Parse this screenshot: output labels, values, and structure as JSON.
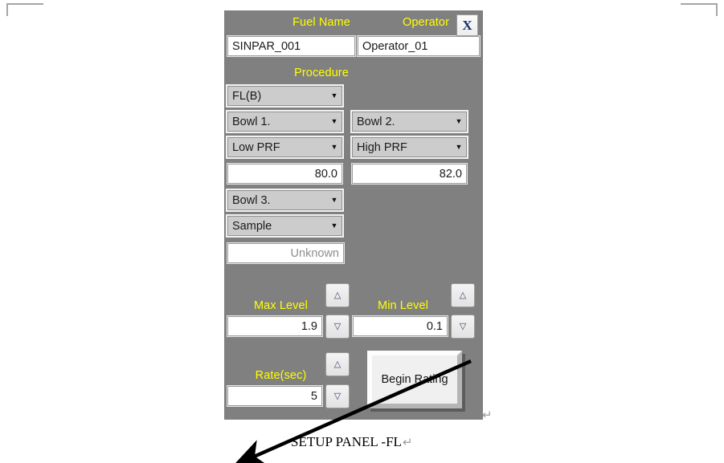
{
  "document": {
    "caption": "SETUP PANEL -FL",
    "paragraph_mark": "↵"
  },
  "panel": {
    "close_button": "X",
    "fields": {
      "fuel_name_label": "Fuel Name",
      "fuel_name_value": "SINPAR_001",
      "operator_label": "Operator",
      "operator_value": "Operator_01",
      "procedure_label": "Procedure",
      "procedure_value": "FL(B)",
      "bowl1_value": "Bowl 1.",
      "bowl2_value": "Bowl 2.",
      "low_prf_value": "Low PRF",
      "high_prf_value": "High PRF",
      "low_prf_number": "80.0",
      "high_prf_number": "82.0",
      "bowl3_value": "Bowl 3.",
      "sample_value": "Sample",
      "sample_number": "Unknown",
      "max_level_label": "Max Level",
      "max_level_value": "1.9",
      "min_level_label": "Min Level",
      "min_level_value": "0.1",
      "rate_label": "Rate(sec)",
      "rate_value": "5",
      "begin_rating_label": "Begin Rating"
    },
    "stepper": {
      "up": "△",
      "down": "▽"
    },
    "dropdown_arrow": "▼"
  },
  "colors": {
    "panel_background": "#808080",
    "label_yellow": "#ffff00",
    "combo_fill": "#cccccc",
    "input_fill": "#ffffff",
    "button_face": "#f0f0f0"
  }
}
